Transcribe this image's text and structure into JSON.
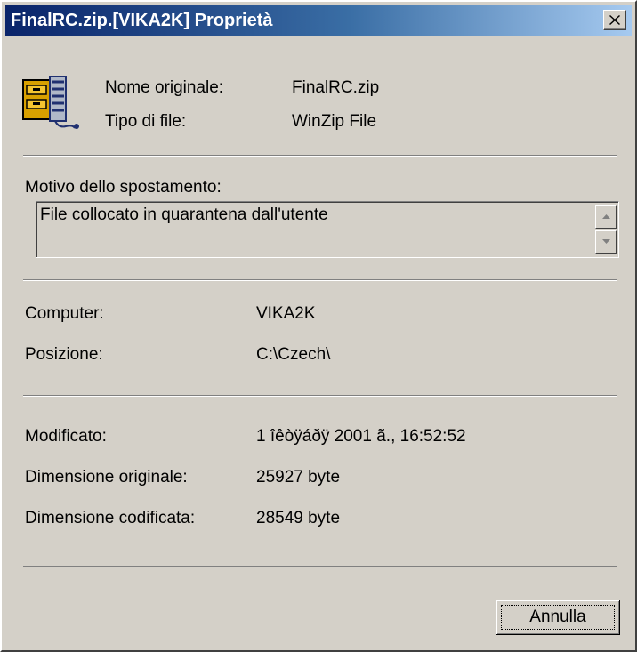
{
  "window": {
    "title": "FinalRC.zip.[VIKA2K] Proprietà",
    "close_glyph": "×"
  },
  "file": {
    "icon": "winzip-archive-icon",
    "name_label": "Nome originale:",
    "name_value": "FinalRC.zip",
    "type_label": "Tipo di file:",
    "type_value": "WinZip File"
  },
  "reason": {
    "label": "Motivo dello spostamento:",
    "text": "File collocato in quarantena dall'utente"
  },
  "location": {
    "computer_label": "Computer:",
    "computer_value": "VIKA2K",
    "position_label": "Posizione:",
    "position_value": "C:\\Czech\\"
  },
  "details": {
    "modified_label": "Modificato:",
    "modified_value": "1 îêòÿáðÿ 2001 ã., 16:52:52",
    "orig_size_label": "Dimensione originale:",
    "orig_size_value": "25927 byte",
    "enc_size_label": "Dimensione codificata:",
    "enc_size_value": "28549 byte"
  },
  "buttons": {
    "cancel_label": "Annulla"
  }
}
